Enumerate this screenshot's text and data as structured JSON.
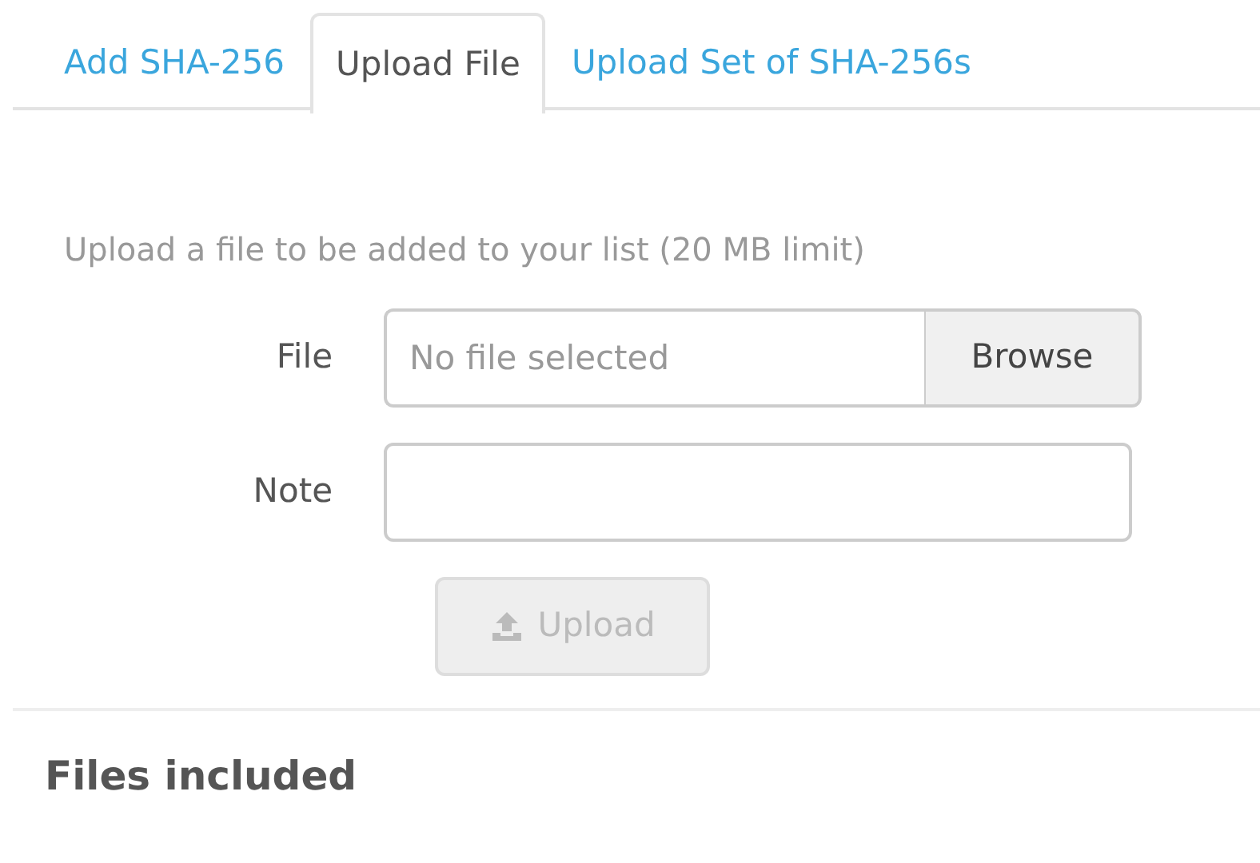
{
  "tabs": [
    {
      "label": "Add SHA-256",
      "selected": false
    },
    {
      "label": "Upload File",
      "selected": true
    },
    {
      "label": "Upload Set of SHA-256s",
      "selected": false
    }
  ],
  "intro": "Upload a file to be added to your list (20 MB limit)",
  "file_field": {
    "label": "File",
    "placeholder": "No file selected",
    "browse": "Browse"
  },
  "note_field": {
    "label": "Note"
  },
  "upload_button": {
    "label": "Upload",
    "disabled": true
  },
  "section_title": "Files included"
}
